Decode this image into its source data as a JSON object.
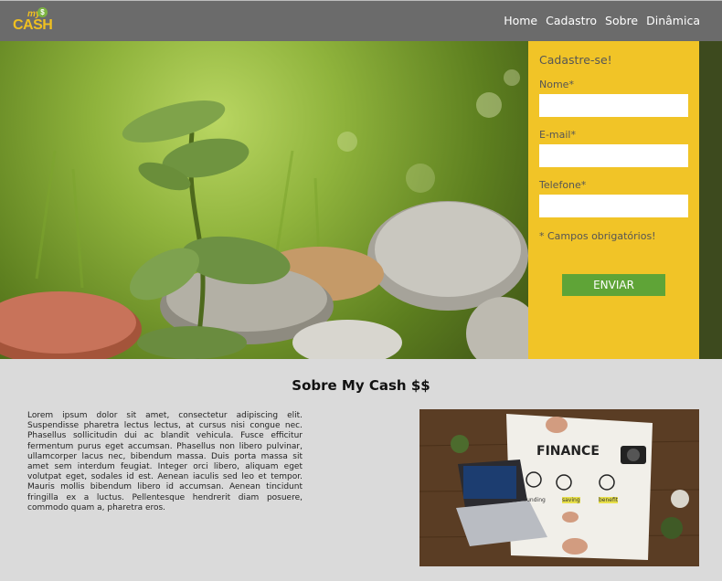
{
  "header": {
    "logo_my": "my",
    "logo_coin": "$",
    "logo_cash": "CASH",
    "nav": [
      "Home",
      "Cadastro",
      "Sobre",
      "Dinâmica"
    ]
  },
  "form": {
    "title": "Cadastre-se!",
    "name_label": "Nome*",
    "email_label": "E-mail*",
    "phone_label": "Telefone*",
    "required_note": "* Campos obrigatórios!",
    "submit_label": "ENVIAR"
  },
  "about": {
    "title": "Sobre My Cash $$",
    "text": "Lorem ipsum dolor sit amet, consectetur adipiscing elit. Suspendisse pharetra lectus lectus, at cursus nisi congue nec. Phasellus sollicitudin dui ac blandit vehicula. Fusce efficitur fermentum purus eget accumsan. Phasellus non libero pulvinar, ullamcorper lacus nec, bibendum massa. Duis porta massa sit amet sem interdum feugiat. Integer orci libero, aliquam eget volutpat eget, sodales id est. Aenean iaculis sed leo et tempor. Mauris mollis bibendum libero id accumsan. Aenean tincidunt fringilla ex a luctus. Pellentesque hendrerit diam posuere, commodo quam a, pharetra eros.",
    "image_text": {
      "heading": "FINANCE",
      "words": [
        "funding",
        "saving",
        "benefit"
      ]
    }
  },
  "colors": {
    "header_bg": "#6b6b6b",
    "form_bg": "#f1c427",
    "button_bg": "#5fa437",
    "section_bg": "#dadada"
  }
}
